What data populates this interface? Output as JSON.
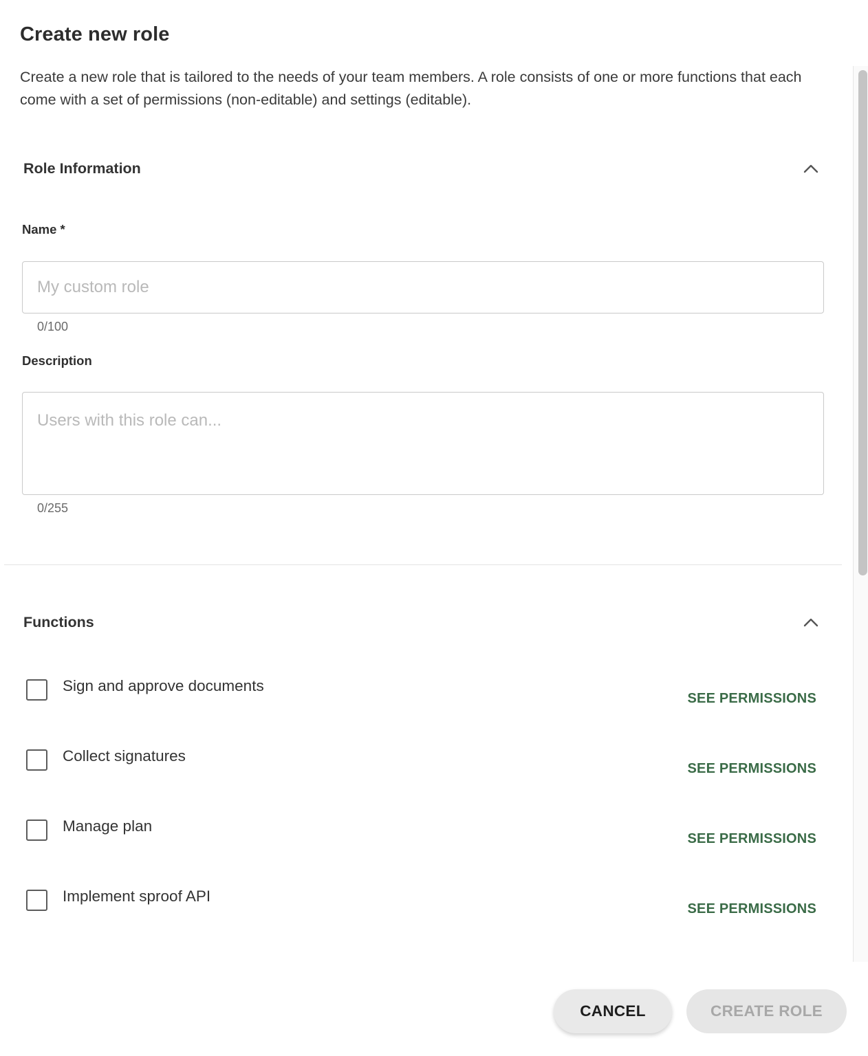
{
  "dialog": {
    "title": "Create new role",
    "intro": "Create a new role that is tailored to the needs of your team members. A role consists of one or more functions that each come with a set of permissions (non-editable) and settings (editable)."
  },
  "role_information": {
    "title": "Role Information",
    "name_label": "Name *",
    "name_placeholder": "My custom role",
    "name_value": "",
    "name_counter": "0/100",
    "description_label": "Description",
    "description_placeholder": "Users with this role can...",
    "description_value": "",
    "description_counter": "0/255"
  },
  "functions": {
    "title": "Functions",
    "see_permissions_label": "SEE PERMISSIONS",
    "items": [
      {
        "label": "Sign and approve documents",
        "checked": false
      },
      {
        "label": "Collect signatures",
        "checked": false
      },
      {
        "label": "Manage plan",
        "checked": false
      },
      {
        "label": "Implement sproof API",
        "checked": false
      }
    ]
  },
  "footer": {
    "cancel_label": "CANCEL",
    "create_label": "CREATE ROLE"
  },
  "icons": {
    "collapse": "chevron-up-icon"
  },
  "colors": {
    "accent_green": "#3a6b47"
  }
}
